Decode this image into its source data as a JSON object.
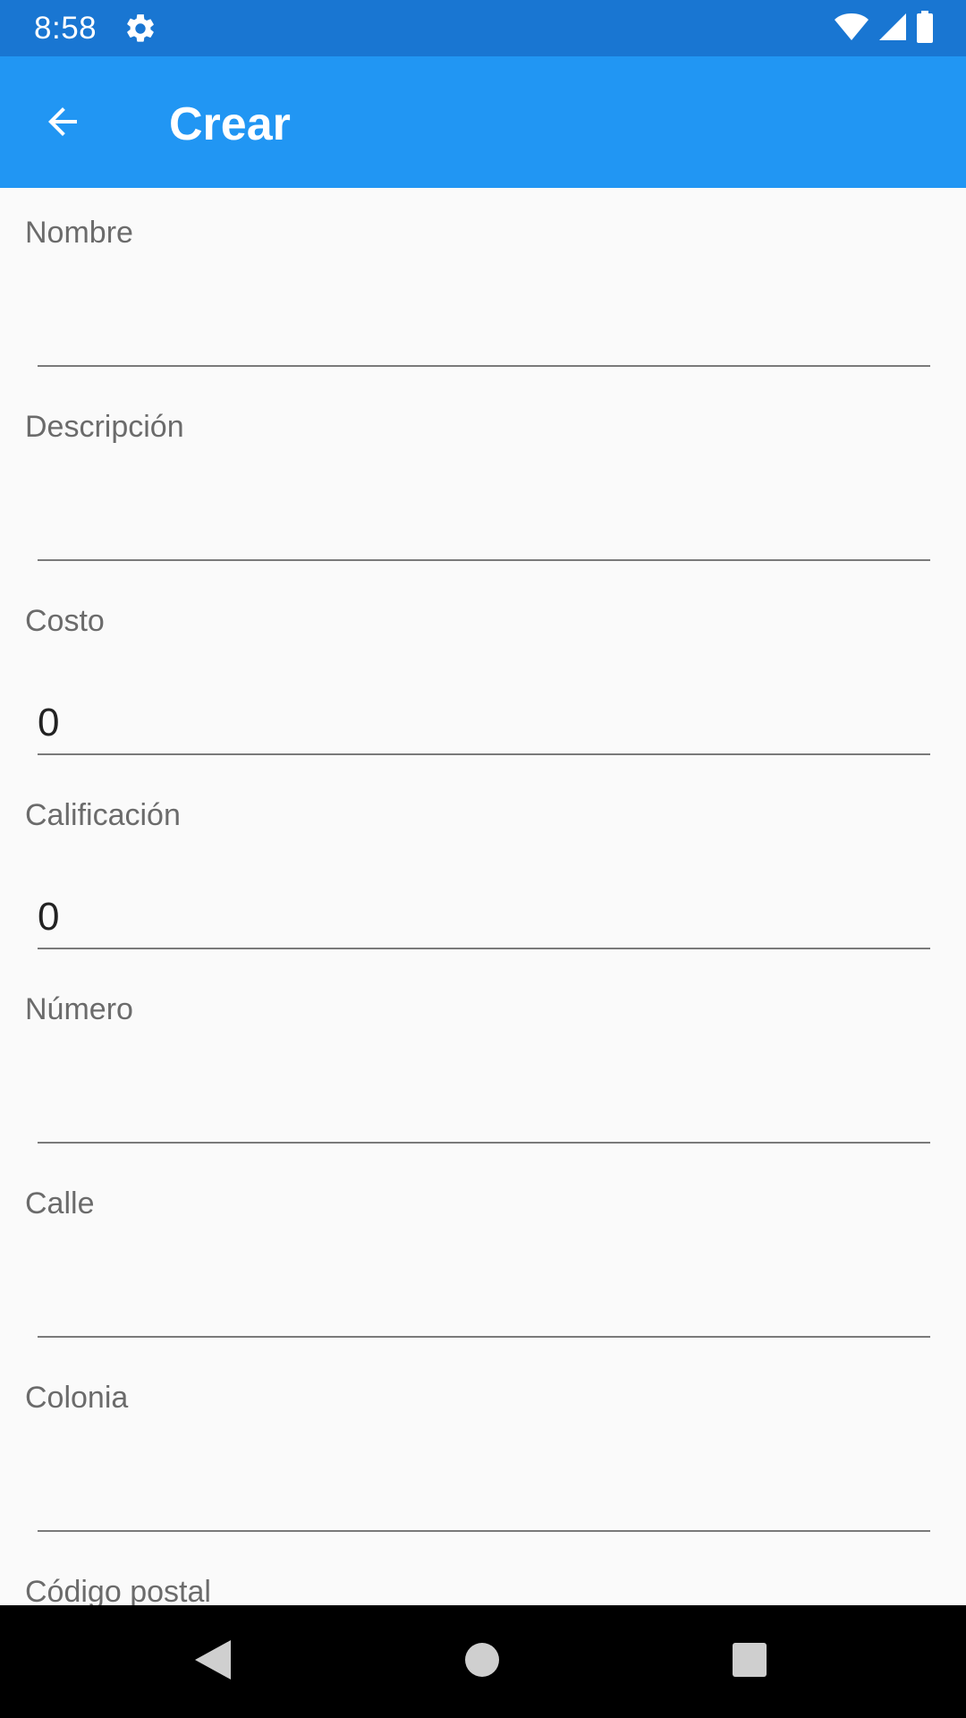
{
  "status_bar": {
    "time": "8:58",
    "icons": [
      "gear-icon",
      "wifi-icon",
      "signal-icon",
      "battery-icon"
    ]
  },
  "app_bar": {
    "back_icon": "arrow-back-icon",
    "title": "Crear",
    "color": "#2196f3"
  },
  "form": {
    "fields": [
      {
        "label": "Nombre",
        "value": ""
      },
      {
        "label": "Descripción",
        "value": ""
      },
      {
        "label": "Costo",
        "value": "0"
      },
      {
        "label": "Calificación",
        "value": "0"
      },
      {
        "label": "Número",
        "value": ""
      },
      {
        "label": "Calle",
        "value": ""
      },
      {
        "label": "Colonia",
        "value": ""
      },
      {
        "label": "Código postal",
        "value": ""
      }
    ]
  },
  "nav_bar": {
    "icons": [
      "back-triangle-icon",
      "home-circle-icon",
      "recents-square-icon"
    ]
  },
  "colors": {
    "status_bar": "#1976d2",
    "app_bar": "#2196f3",
    "background": "#fafafa"
  }
}
